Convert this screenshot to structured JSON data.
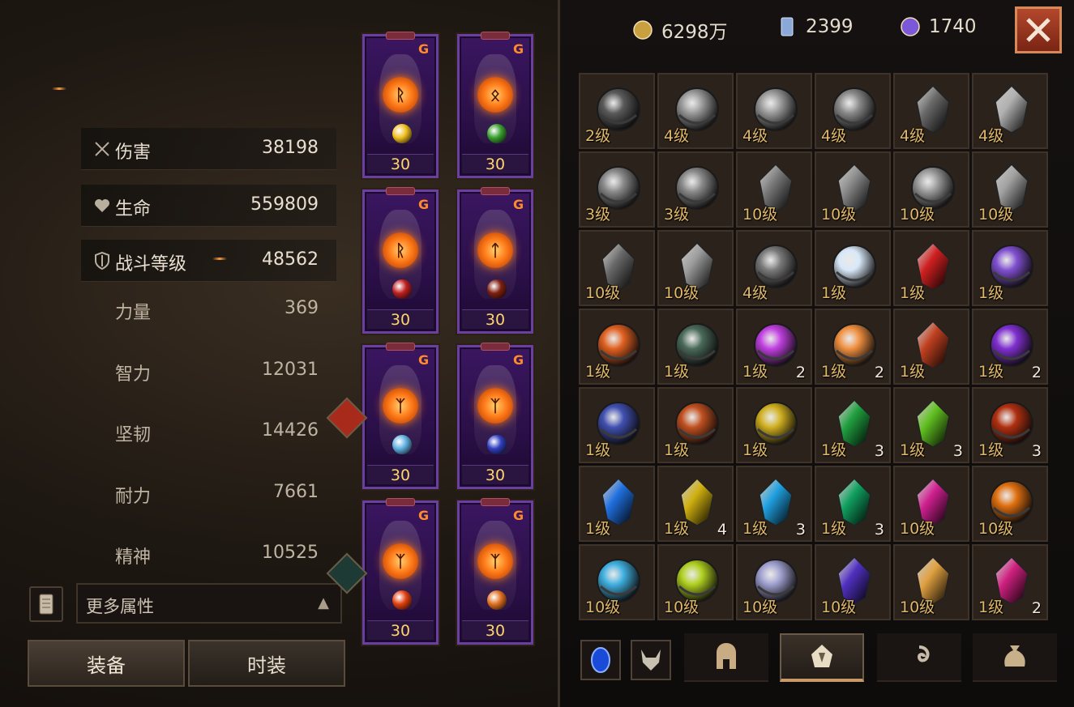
{
  "stats": {
    "main": [
      {
        "label": "伤害",
        "value": "38198",
        "icon": "crossed-swords-icon"
      },
      {
        "label": "生命",
        "value": "559809",
        "icon": "heart-icon"
      },
      {
        "label": "战斗等级",
        "value": "48562",
        "icon": "shield-icon"
      }
    ],
    "sub": [
      {
        "label": "力量",
        "value": "369"
      },
      {
        "label": "智力",
        "value": "12031"
      },
      {
        "label": "坚韧",
        "value": "14426"
      },
      {
        "label": "耐力",
        "value": "7661"
      },
      {
        "label": "精神",
        "value": "10525"
      }
    ]
  },
  "more": {
    "label": "更多属性",
    "arrow": "▲"
  },
  "tabs": {
    "equip": "装备",
    "fashion": "时装"
  },
  "equipment": [
    {
      "level": "30",
      "rune": "ᚱ",
      "gem_color": "#f0c020"
    },
    {
      "level": "30",
      "rune": "ᛟ",
      "gem_color": "#3aa030"
    },
    {
      "level": "30",
      "rune": "ᚱ",
      "gem_color": "#c02020"
    },
    {
      "level": "30",
      "rune": "ᛏ",
      "gem_color": "#802010"
    },
    {
      "level": "30",
      "rune": "ᛉ",
      "gem_color": "#60b0e0"
    },
    {
      "level": "30",
      "rune": "ᛉ",
      "gem_color": "#3040c0"
    },
    {
      "level": "30",
      "rune": "ᛉ",
      "gem_color": "#e04010"
    },
    {
      "level": "30",
      "rune": "ᛉ",
      "gem_color": "#e07020"
    }
  ],
  "currency": [
    {
      "icon": "gold-coin-icon",
      "value": "6298万",
      "color": "#c8a040"
    },
    {
      "icon": "blue-crystal-icon",
      "value": "2399",
      "color": "#8aa8d8"
    },
    {
      "icon": "purple-orb-icon",
      "value": "1740",
      "color": "#7a58d8"
    }
  ],
  "inventory": [
    {
      "level": "2级",
      "count": "",
      "color": "#5a5a5a",
      "shape": "orb"
    },
    {
      "level": "4级",
      "count": "",
      "color": "#9a9a9a",
      "shape": "orb"
    },
    {
      "level": "4级",
      "count": "",
      "color": "#9a9a9a",
      "shape": "orb"
    },
    {
      "level": "4级",
      "count": "",
      "color": "#8a8a8a",
      "shape": "orb"
    },
    {
      "level": "4级",
      "count": "",
      "color": "#6a6a6a",
      "shape": "shard"
    },
    {
      "level": "4级",
      "count": "",
      "color": "#b0b0b0",
      "shape": "shard"
    },
    {
      "level": "3级",
      "count": "",
      "color": "#8a8a8a",
      "shape": "orb"
    },
    {
      "level": "3级",
      "count": "",
      "color": "#8a8a8a",
      "shape": "orb"
    },
    {
      "level": "10级",
      "count": "",
      "color": "#7a7a7a",
      "shape": "shard"
    },
    {
      "level": "10级",
      "count": "",
      "color": "#8a8a8a",
      "shape": "shard"
    },
    {
      "level": "10级",
      "count": "",
      "color": "#9a9a9a",
      "shape": "orb"
    },
    {
      "level": "10级",
      "count": "",
      "color": "#a0a0a0",
      "shape": "shard"
    },
    {
      "level": "10级",
      "count": "",
      "color": "#6a6a6a",
      "shape": "shard"
    },
    {
      "level": "10级",
      "count": "",
      "color": "#9a9a9a",
      "shape": "shard"
    },
    {
      "level": "4级",
      "count": "",
      "color": "#7a7a7a",
      "shape": "orb"
    },
    {
      "level": "1级",
      "count": "",
      "color": "#d8e8f8",
      "shape": "orb"
    },
    {
      "level": "1级",
      "count": "",
      "color": "#d02020",
      "shape": "shard"
    },
    {
      "level": "1级",
      "count": "",
      "color": "#8050d0",
      "shape": "orb"
    },
    {
      "level": "1级",
      "count": "",
      "color": "#e06020",
      "shape": "orb"
    },
    {
      "level": "1级",
      "count": "",
      "color": "#4a6a5a",
      "shape": "orb"
    },
    {
      "level": "1级",
      "count": "2",
      "color": "#c040e0",
      "shape": "orb"
    },
    {
      "level": "1级",
      "count": "2",
      "color": "#f09040",
      "shape": "orb"
    },
    {
      "level": "1级",
      "count": "",
      "color": "#c04020",
      "shape": "shard"
    },
    {
      "level": "1级",
      "count": "2",
      "color": "#8030d0",
      "shape": "orb"
    },
    {
      "level": "1级",
      "count": "",
      "color": "#4050b0",
      "shape": "orb"
    },
    {
      "level": "1级",
      "count": "",
      "color": "#c05020",
      "shape": "orb"
    },
    {
      "level": "1级",
      "count": "",
      "color": "#d0b020",
      "shape": "orb"
    },
    {
      "level": "1级",
      "count": "3",
      "color": "#20a040",
      "shape": "shard"
    },
    {
      "level": "1级",
      "count": "3",
      "color": "#60c020",
      "shape": "shard"
    },
    {
      "level": "1级",
      "count": "3",
      "color": "#b03010",
      "shape": "orb"
    },
    {
      "level": "1级",
      "count": "",
      "color": "#2070e0",
      "shape": "shard"
    },
    {
      "level": "1级",
      "count": "4",
      "color": "#d0b010",
      "shape": "shard"
    },
    {
      "level": "1级",
      "count": "3",
      "color": "#20a0e0",
      "shape": "shard"
    },
    {
      "level": "1级",
      "count": "3",
      "color": "#10a060",
      "shape": "shard"
    },
    {
      "level": "10级",
      "count": "",
      "color": "#d02090",
      "shape": "shard"
    },
    {
      "level": "10级",
      "count": "",
      "color": "#e07010",
      "shape": "orb"
    },
    {
      "level": "10级",
      "count": "",
      "color": "#40b0e0",
      "shape": "orb"
    },
    {
      "level": "10级",
      "count": "",
      "color": "#b0d020",
      "shape": "orb"
    },
    {
      "level": "10级",
      "count": "",
      "color": "#a0a0d0",
      "shape": "orb"
    },
    {
      "level": "10级",
      "count": "",
      "color": "#5030c0",
      "shape": "shard"
    },
    {
      "level": "10级",
      "count": "",
      "color": "#e0a040",
      "shape": "shard"
    },
    {
      "level": "1级",
      "count": "2",
      "color": "#d02080",
      "shape": "shard"
    }
  ],
  "bottom_tabs": [
    {
      "icon": "blue-gem-icon"
    },
    {
      "icon": "horned-helm-icon"
    },
    {
      "icon": "helmet-icon"
    },
    {
      "icon": "rune-stone-icon"
    },
    {
      "icon": "spiral-rune-icon"
    },
    {
      "icon": "bag-icon"
    }
  ]
}
